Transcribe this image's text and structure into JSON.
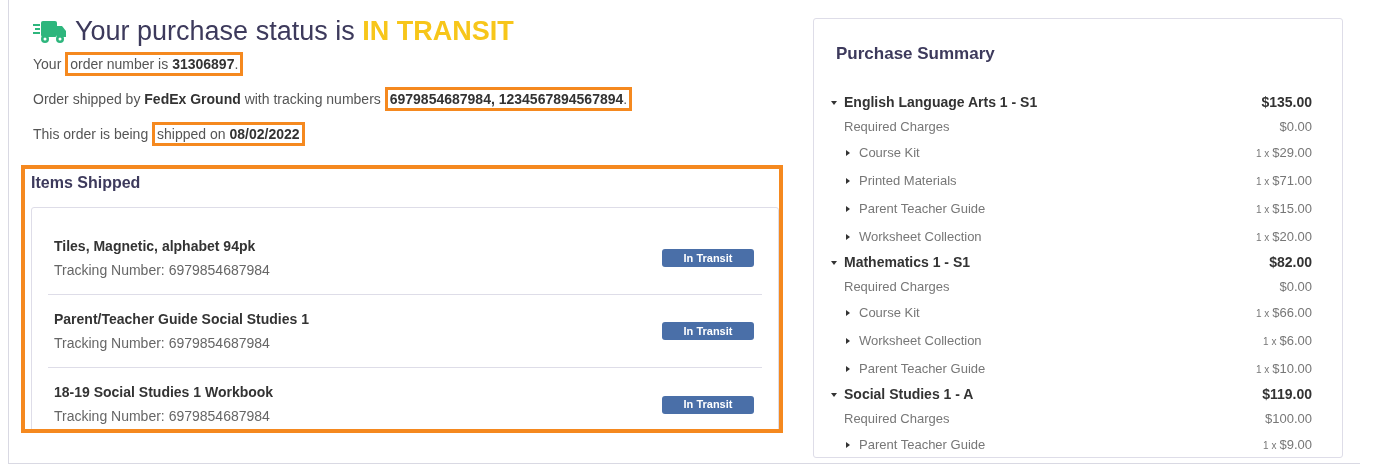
{
  "status": {
    "prefix": "Your purchase status is",
    "value": "IN TRANSIT"
  },
  "details": [
    {
      "before": "Your ",
      "marked": "order number is **31306897**.",
      "highlighted": true
    },
    {
      "before": "Order shipped by **FedEx Ground** with tracking numbers ",
      "marked": "**6979854687984, 1234567894567894**.",
      "highlighted": true
    },
    {
      "before": "This order is being ",
      "marked": "shipped on **08/02/2022**",
      "highlighted": true
    }
  ],
  "items_shipped": {
    "title": "Items Shipped",
    "highlighted": true,
    "items": [
      {
        "name": "Tiles, Magnetic, alphabet 94pk",
        "tracking": "Tracking Number: 6979854687984",
        "badge": "In Transit"
      },
      {
        "name": "Parent/Teacher Guide Social Studies 1",
        "tracking": "Tracking Number: 6979854687984",
        "badge": "In Transit"
      },
      {
        "name": "18-19 Social Studies 1 Workbook",
        "tracking": "Tracking Number: 6979854687984",
        "badge": "In Transit"
      }
    ]
  },
  "purchase_summary": {
    "title": "Purchase Summary",
    "courses": [
      {
        "name": "English Language Arts 1 - S1",
        "total": "$135.00",
        "expanded": true,
        "required_label": "Required Charges",
        "required_amount": "$0.00",
        "children": [
          {
            "name": "Course Kit",
            "qty": "1 x",
            "price": "$29.00",
            "expanded": false
          },
          {
            "name": "Printed Materials",
            "qty": "1 x",
            "price": "$71.00",
            "expanded": false
          },
          {
            "name": "Parent Teacher Guide",
            "qty": "1 x",
            "price": "$15.00",
            "expanded": false
          },
          {
            "name": "Worksheet Collection",
            "qty": "1 x",
            "price": "$20.00",
            "expanded": false
          }
        ]
      },
      {
        "name": "Mathematics 1 - S1",
        "total": "$82.00",
        "expanded": true,
        "required_label": "Required Charges",
        "required_amount": "$0.00",
        "children": [
          {
            "name": "Course Kit",
            "qty": "1 x",
            "price": "$66.00",
            "expanded": false
          },
          {
            "name": "Worksheet Collection",
            "qty": "1 x",
            "price": "$6.00",
            "expanded": false
          },
          {
            "name": "Parent Teacher Guide",
            "qty": "1 x",
            "price": "$10.00",
            "expanded": false
          }
        ]
      },
      {
        "name": "Social Studies 1 - A",
        "total": "$119.00",
        "expanded": true,
        "required_label": "Required Charges",
        "required_amount": "$100.00",
        "children": [
          {
            "name": "Parent Teacher Guide",
            "qty": "1 x",
            "price": "$9.00",
            "expanded": false
          }
        ]
      }
    ]
  }
}
